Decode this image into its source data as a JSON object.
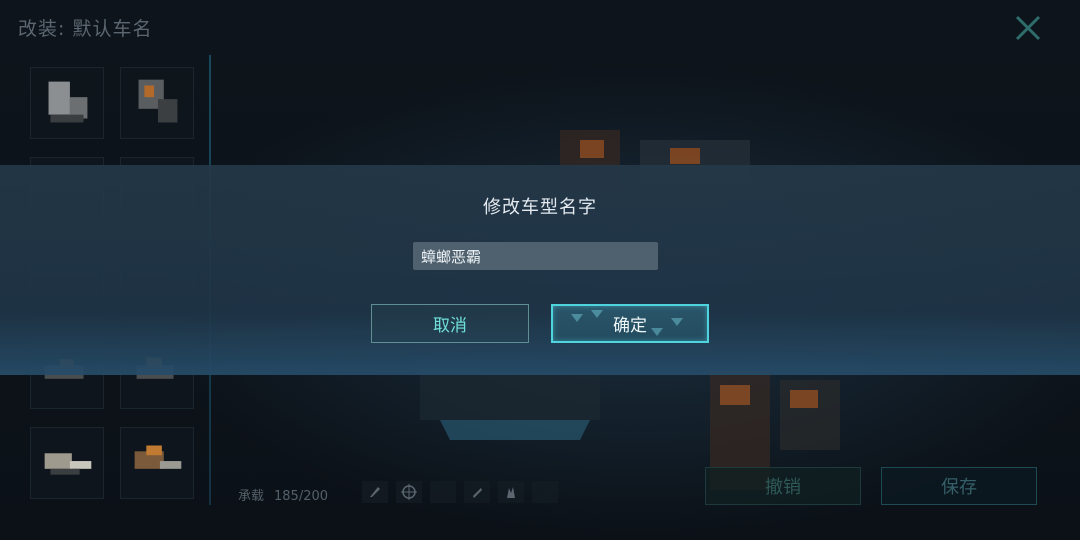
{
  "header": {
    "title": "改装: 默认车名"
  },
  "load": {
    "label": "承载",
    "value": "185/200"
  },
  "actions": {
    "undo_label": "撤销",
    "save_label": "保存"
  },
  "modal": {
    "title": "修改车型名字",
    "name_value": "蟑螂恶霸",
    "cancel_label": "取消",
    "confirm_label": "确定"
  },
  "colors": {
    "accent": "#4fd4de",
    "cancel_text": "#6fe0da",
    "modal_bg": "#243848"
  },
  "icons": [
    "close-icon",
    "rocket-icon",
    "crosshair-icon",
    "wrench-icon",
    "claw-icon"
  ]
}
